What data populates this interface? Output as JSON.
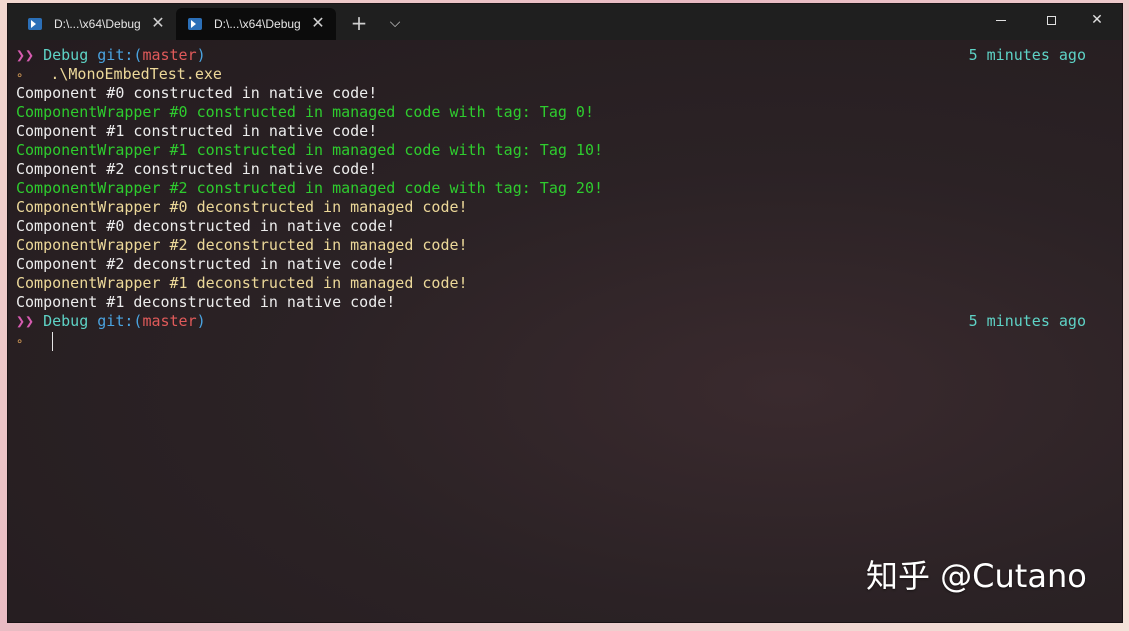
{
  "tabs": [
    {
      "label": "D:\\...\\x64\\Debug",
      "active": false
    },
    {
      "label": "D:\\...\\x64\\Debug",
      "active": true
    }
  ],
  "titlebar": {
    "close_glyph": "✕",
    "new_tab_glyph": "+",
    "dropdown_glyph": "⌵"
  },
  "prompt1": {
    "arrow": "❯❯",
    "dir": "Debug",
    "git_prefix": "git:(",
    "branch": "master",
    "git_suffix": ")",
    "time": "5 minutes ago",
    "marker": "∘",
    "command": ".\\MonoEmbedTest.exe"
  },
  "output": [
    {
      "text": "Component #0 constructed in native code!",
      "color": "white"
    },
    {
      "text": "ComponentWrapper #0 constructed in managed code with tag: Tag 0!",
      "color": "green"
    },
    {
      "text": "Component #1 constructed in native code!",
      "color": "white"
    },
    {
      "text": "ComponentWrapper #1 constructed in managed code with tag: Tag 10!",
      "color": "green"
    },
    {
      "text": "Component #2 constructed in native code!",
      "color": "white"
    },
    {
      "text": "ComponentWrapper #2 constructed in managed code with tag: Tag 20!",
      "color": "green"
    },
    {
      "text": "ComponentWrapper #0 deconstructed in managed code!",
      "color": "yellow"
    },
    {
      "text": "Component #0 deconstructed in native code!",
      "color": "white"
    },
    {
      "text": "ComponentWrapper #2 deconstructed in managed code!",
      "color": "yellow"
    },
    {
      "text": "Component #2 deconstructed in native code!",
      "color": "white"
    },
    {
      "text": "ComponentWrapper #1 deconstructed in managed code!",
      "color": "yellow"
    },
    {
      "text": "Component #1 deconstructed in native code!",
      "color": "white"
    }
  ],
  "prompt2": {
    "arrow": "❯❯",
    "dir": "Debug",
    "git_prefix": "git:(",
    "branch": "master",
    "git_suffix": ")",
    "time": "5 minutes ago",
    "marker": "∘"
  },
  "watermark": "知乎 @Cutano"
}
